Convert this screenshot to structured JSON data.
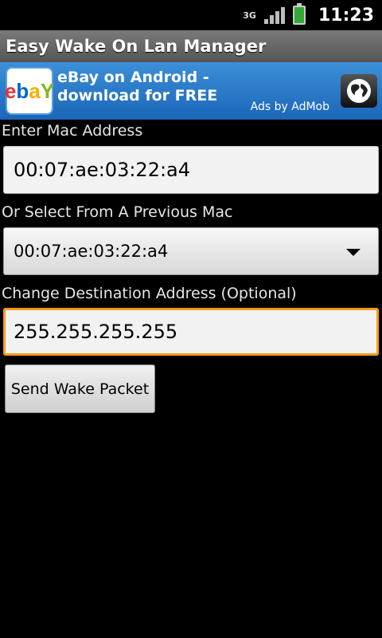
{
  "status_bar": {
    "network": "3G",
    "time": "11:23"
  },
  "app": {
    "title": "Easy Wake On Lan Manager"
  },
  "ad": {
    "logo_letters": [
      "e",
      "b",
      "a",
      "Y"
    ],
    "headline": "eBay on Android - download for FREE",
    "attribution": "Ads by AdMob"
  },
  "form": {
    "mac_label": "Enter Mac Address",
    "mac_value": "00:07:ae:03:22:a4",
    "previous_label": "Or Select From A Previous Mac",
    "previous_selected": "00:07:ae:03:22:a4",
    "destination_label": "Change Destination Address (Optional)",
    "destination_value": "255.255.255.255",
    "send_button": "Send Wake Packet"
  },
  "colors": {
    "focus_border": "#ff9a1a",
    "ad_background": "#1b66b8"
  }
}
